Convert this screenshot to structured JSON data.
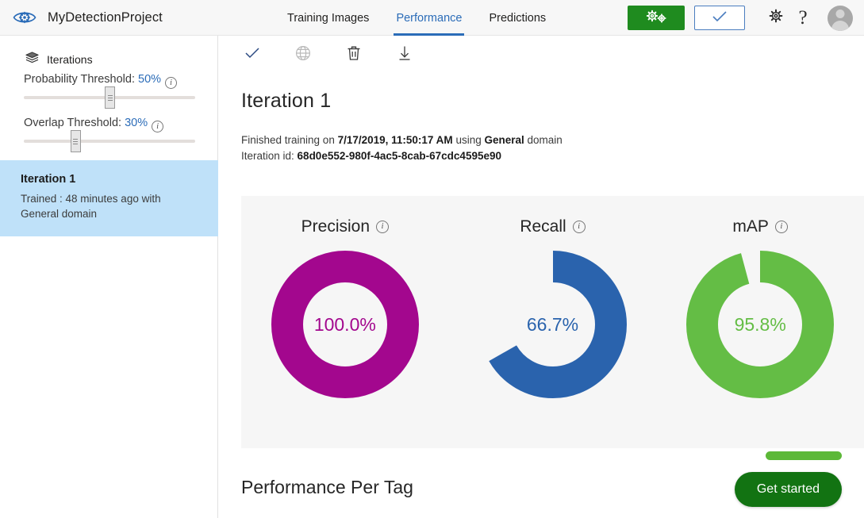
{
  "header": {
    "logo_icon": "eye-gear-icon",
    "project_title": "MyDetectionProject",
    "nav": [
      {
        "label": "Training Images",
        "active": false
      },
      {
        "label": "Performance",
        "active": true
      },
      {
        "label": "Predictions",
        "active": false
      }
    ],
    "train_button": {
      "icon": "double-gear-icon",
      "color": "#1f8b1f"
    },
    "quick_test_button": {
      "icon": "checkmark-icon",
      "border_color": "#4a7dbf"
    },
    "settings_icon": "gear-icon",
    "help_icon": "question-mark-icon",
    "avatar_icon": "user-avatar-icon"
  },
  "sidebar": {
    "section_icon": "layers-icon",
    "section_label": "Iterations",
    "sliders": [
      {
        "label_prefix": "Probability Threshold: ",
        "value_text": "50%",
        "value_pct": 50,
        "info_icon": "info-icon"
      },
      {
        "label_prefix": "Overlap Threshold: ",
        "value_text": "30%",
        "value_pct": 30,
        "info_icon": "info-icon"
      }
    ],
    "iterations": [
      {
        "title": "Iteration 1",
        "subtitle": "Trained : 48 minutes ago with General domain",
        "selected": true,
        "selected_color": "#bfe1f9"
      }
    ]
  },
  "main": {
    "toolbar": [
      {
        "icon": "checkmark-icon",
        "name": "set-default-iteration",
        "color": "#2b4a82"
      },
      {
        "icon": "globe-icon",
        "name": "publish-iteration",
        "color": "#b9b9b9"
      },
      {
        "icon": "trash-icon",
        "name": "delete-iteration",
        "color": "#3a3a3a"
      },
      {
        "icon": "download-icon",
        "name": "export-iteration",
        "color": "#3a3a3a"
      }
    ],
    "page_title": "Iteration 1",
    "meta_line_1_prefix": "Finished training on ",
    "meta_date": "7/17/2019, 11:50:17 AM",
    "meta_line_1_mid": " using ",
    "meta_domain": "General",
    "meta_line_1_suffix": " domain",
    "meta_line_2_prefix": "Iteration id: ",
    "meta_iteration_id": "68d0e552-980f-4ac5-8cab-67cdc4595e90",
    "per_tag_title": "Performance Per Tag",
    "get_started_label": "Get started",
    "get_started_color": "#127312",
    "pill_color": "#5cb838"
  },
  "chart_data": [
    {
      "type": "pie",
      "title": "Precision",
      "value_label": "100.0%",
      "value": 100.0,
      "max": 100,
      "color": "#a3078e",
      "track_color": "#f6f6f6",
      "info_icon": "info-icon"
    },
    {
      "type": "pie",
      "title": "Recall",
      "value_label": "66.7%",
      "value": 66.7,
      "max": 100,
      "color": "#2a63ad",
      "track_color": "#f6f6f6",
      "info_icon": "info-icon"
    },
    {
      "type": "pie",
      "title": "mAP",
      "value_label": "95.8%",
      "value": 95.8,
      "max": 100,
      "color": "#64bd45",
      "track_color": "#f6f6f6",
      "info_icon": "info-icon"
    }
  ]
}
